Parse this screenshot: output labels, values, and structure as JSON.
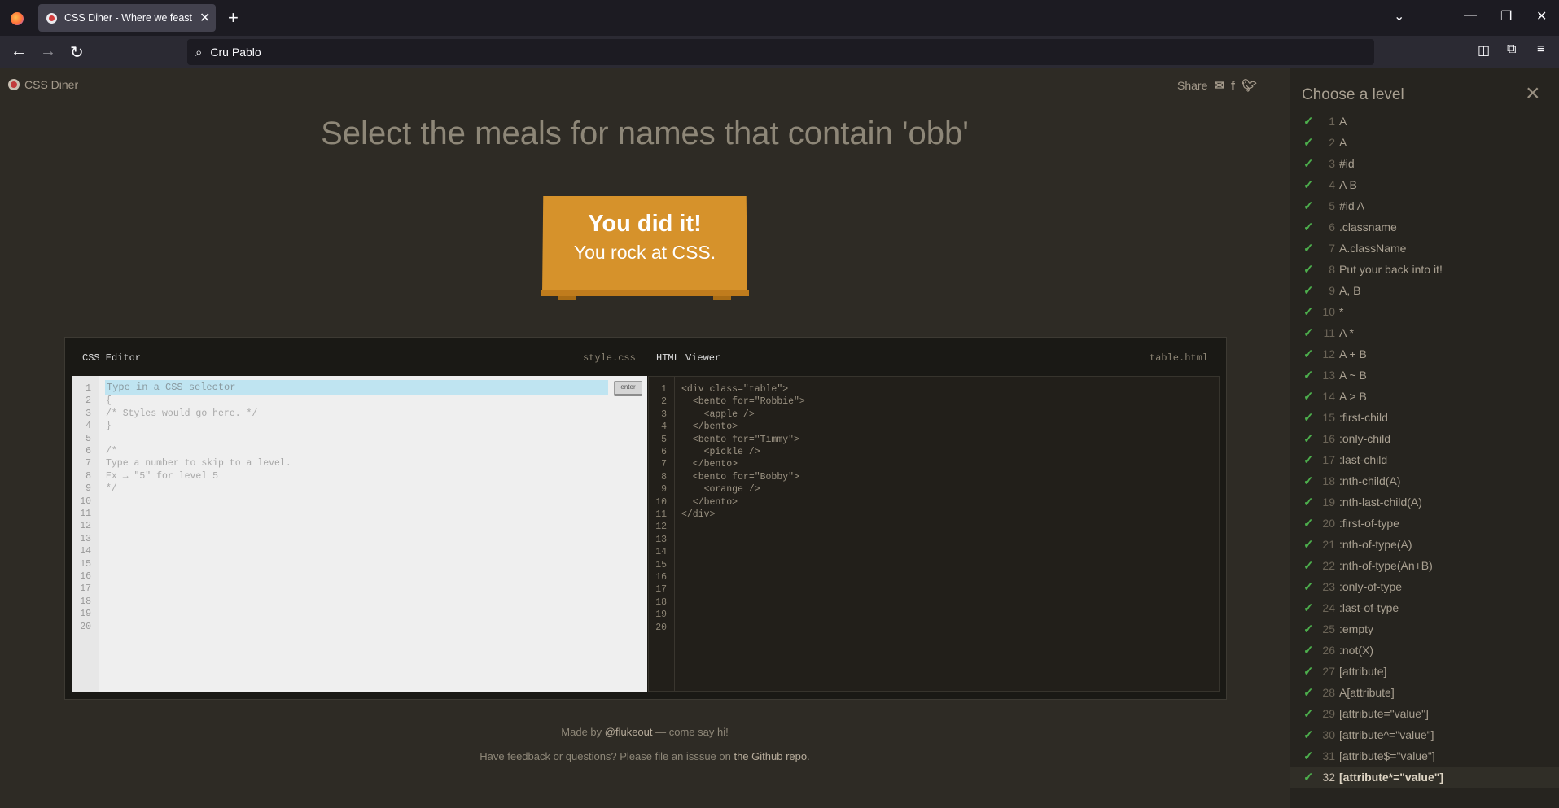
{
  "browser": {
    "tab_title": "CSS Diner - Where we feast on CSS Selectors!",
    "address_text": "Cru Pablo"
  },
  "page": {
    "logo_text": "CSS Diner",
    "share_label": "Share",
    "order_text": "Select the meals for names that contain 'obb'",
    "sign_line1": "You did it!",
    "sign_line2": "You rock at CSS."
  },
  "editor": {
    "css_title": "CSS Editor",
    "css_file": "style.css",
    "html_title": "HTML Viewer",
    "html_file": "table.html",
    "input_placeholder": "Type in a CSS selector",
    "enter_label": "enter",
    "line_numbers": [
      "1",
      "2",
      "3",
      "4",
      "5",
      "6",
      "7",
      "8",
      "9",
      "10",
      "11",
      "12",
      "13",
      "14",
      "15",
      "16",
      "17",
      "18",
      "19",
      "20"
    ],
    "css_lines": [
      "",
      "{",
      "/* Styles would go here. */",
      "}",
      "",
      "/*",
      "Type a number to skip to a level.",
      "Ex → \"5\" for level 5",
      "*/"
    ],
    "html_lines": [
      "<div class=\"table\">",
      "  <bento for=\"Robbie\">",
      "    <apple />",
      "  </bento>",
      "  <bento for=\"Timmy\">",
      "    <pickle />",
      "  </bento>",
      "  <bento for=\"Bobby\">",
      "    <orange />",
      "  </bento>",
      "</div>"
    ]
  },
  "footer": {
    "made_by_prefix": "Made by ",
    "made_by_link": "@flukeout",
    "made_by_suffix": " — come say hi!",
    "feedback_prefix": "Have feedback or questions? Please file an isssue on ",
    "feedback_link": "the Github repo",
    "feedback_suffix": "."
  },
  "sidebar": {
    "title": "Choose a level",
    "levels": [
      {
        "num": "1",
        "name": "A"
      },
      {
        "num": "2",
        "name": "A"
      },
      {
        "num": "3",
        "name": "#id"
      },
      {
        "num": "4",
        "name": "A  B"
      },
      {
        "num": "5",
        "name": "#id  A"
      },
      {
        "num": "6",
        "name": ".classname"
      },
      {
        "num": "7",
        "name": "A.className"
      },
      {
        "num": "8",
        "name": "Put your back into it!"
      },
      {
        "num": "9",
        "name": "A, B"
      },
      {
        "num": "10",
        "name": "*"
      },
      {
        "num": "11",
        "name": "A  *"
      },
      {
        "num": "12",
        "name": "A + B"
      },
      {
        "num": "13",
        "name": "A ~ B"
      },
      {
        "num": "14",
        "name": "A > B"
      },
      {
        "num": "15",
        "name": ":first-child"
      },
      {
        "num": "16",
        "name": ":only-child"
      },
      {
        "num": "17",
        "name": ":last-child"
      },
      {
        "num": "18",
        "name": ":nth-child(A)"
      },
      {
        "num": "19",
        "name": ":nth-last-child(A)"
      },
      {
        "num": "20",
        "name": ":first-of-type"
      },
      {
        "num": "21",
        "name": ":nth-of-type(A)"
      },
      {
        "num": "22",
        "name": ":nth-of-type(An+B)"
      },
      {
        "num": "23",
        "name": ":only-of-type"
      },
      {
        "num": "24",
        "name": ":last-of-type"
      },
      {
        "num": "25",
        "name": ":empty"
      },
      {
        "num": "26",
        "name": ":not(X)"
      },
      {
        "num": "27",
        "name": "[attribute]"
      },
      {
        "num": "28",
        "name": "A[attribute]"
      },
      {
        "num": "29",
        "name": "[attribute=\"value\"]"
      },
      {
        "num": "30",
        "name": "[attribute^=\"value\"]"
      },
      {
        "num": "31",
        "name": "[attribute$=\"value\"]"
      },
      {
        "num": "32",
        "name": "[attribute*=\"value\"]"
      }
    ],
    "active_level": "32"
  },
  "colors": {
    "page_bg": "#2e2b25",
    "sign": "#d6922b",
    "check": "#4cae4c"
  }
}
